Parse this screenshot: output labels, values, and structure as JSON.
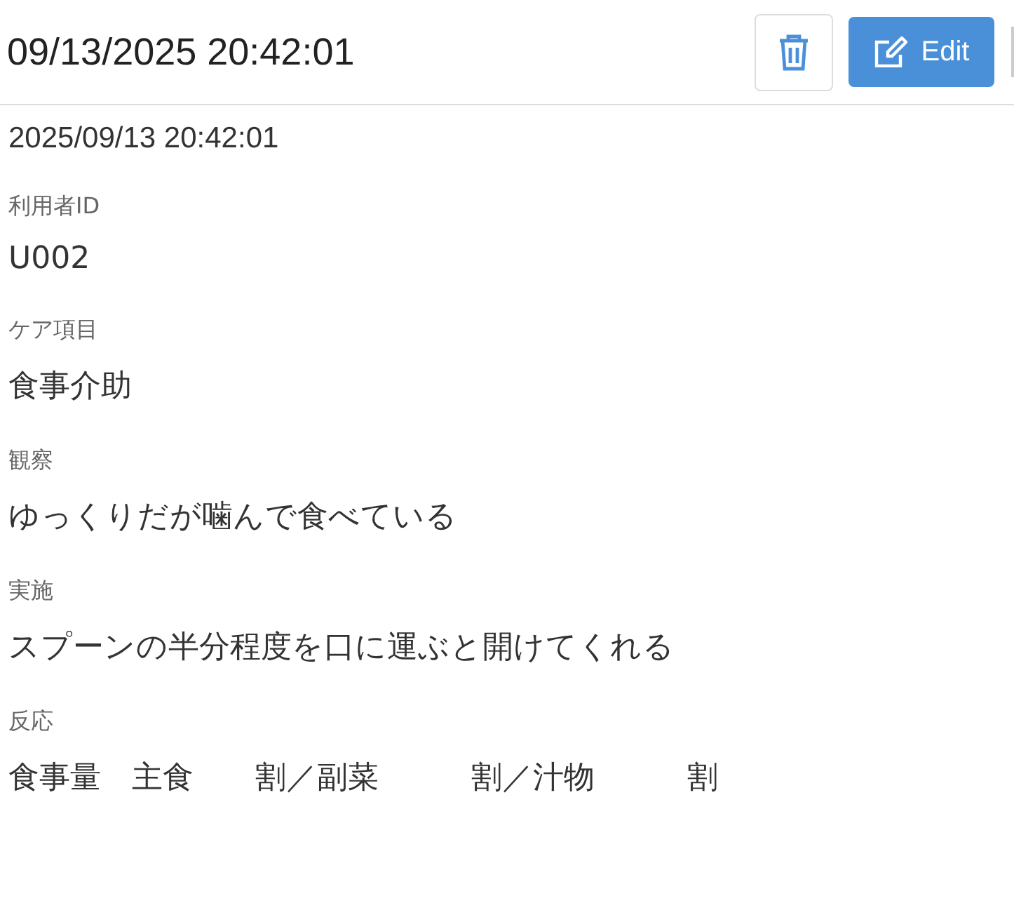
{
  "header": {
    "title": "09/13/2025 20:42:01",
    "edit_label": "Edit"
  },
  "timestamp": "2025/09/13 20:42:01",
  "fields": [
    {
      "label": "利用者ID",
      "value": "U002"
    },
    {
      "label": "ケア項目",
      "value": "食事介助"
    },
    {
      "label": "観察",
      "value": "ゆっくりだが噛んで食べている"
    },
    {
      "label": "実施",
      "value": "スプーンの半分程度を口に運ぶと開けてくれる"
    },
    {
      "label": "反応",
      "value": "食事量　主食　　割／副菜　　　割／汁物　　　割"
    }
  ]
}
